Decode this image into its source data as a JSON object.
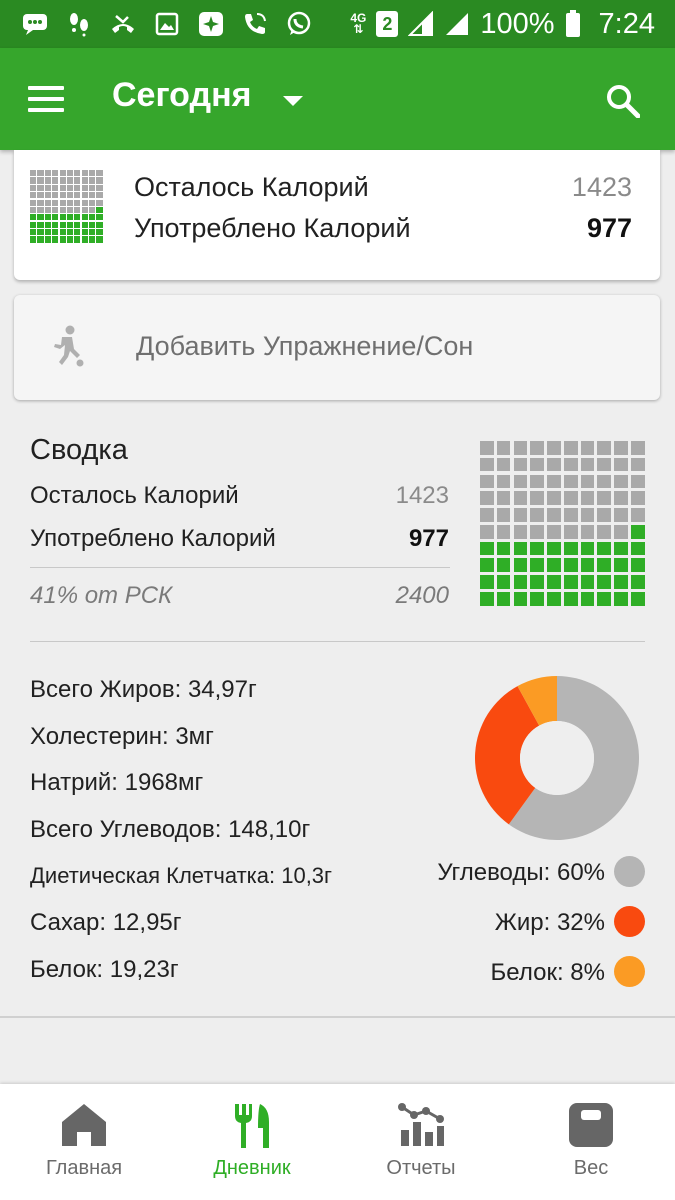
{
  "status_bar": {
    "network": "4G",
    "sim": "2",
    "battery": "100%",
    "time": "7:24"
  },
  "app_bar": {
    "title": "Сегодня"
  },
  "calorie_card": {
    "remaining_label": "Осталось Калорий",
    "remaining_value": "1423",
    "consumed_label": "Употреблено Калорий",
    "consumed_value": "977",
    "filled_fraction": 0.41
  },
  "exercise_button": {
    "label": "Добавить Упражнение/Сон"
  },
  "summary": {
    "title": "Сводка",
    "remaining_label": "Осталось Калорий",
    "remaining_value": "1423",
    "consumed_label": "Употреблено Калорий",
    "consumed_value": "977",
    "rsk_label": "41% от РСК",
    "rsk_value": "2400",
    "filled_fraction": 0.41
  },
  "nutrients": [
    "Всего Жиров: 34,97г",
    "Холестерин: 3мг",
    "Натрий: 1968мг",
    "Всего Углеводов: 148,10г",
    "Диетическая Клетчатка: 10,3г",
    "Сахар: 12,95г",
    "Белок: 19,23г"
  ],
  "macros": [
    {
      "label": "Углеводы: 60%",
      "percent": 60,
      "color": "#b5b5b5"
    },
    {
      "label": "Жир: 32%",
      "percent": 32,
      "color": "#f94a0f"
    },
    {
      "label": "Белок: 8%",
      "percent": 8,
      "color": "#fb9b24"
    }
  ],
  "bottom_nav": [
    {
      "label": "Главная",
      "icon": "home-icon",
      "active": false
    },
    {
      "label": "Дневник",
      "icon": "fork-knife-icon",
      "active": true
    },
    {
      "label": "Отчеты",
      "icon": "reports-icon",
      "active": false
    },
    {
      "label": "Вес",
      "icon": "scale-icon",
      "active": false
    }
  ],
  "colors": {
    "status_bar": "#2a8a22",
    "app_bar": "#36a62c",
    "accent_green": "#2fae26",
    "grid_gray": "#a9a9a9"
  }
}
